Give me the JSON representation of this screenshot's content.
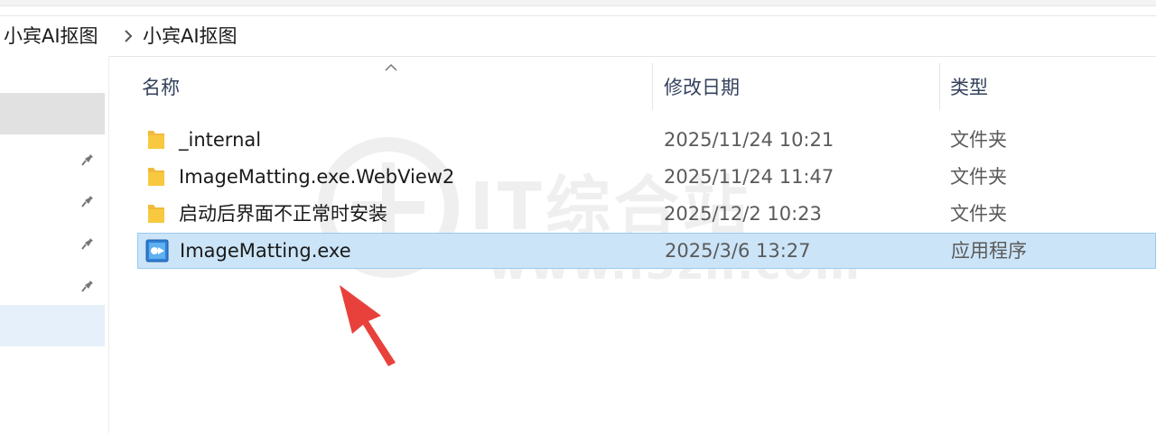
{
  "breadcrumb": {
    "items": [
      "小宾AI抠图",
      "小宾AI抠图"
    ]
  },
  "columns": {
    "name": "名称",
    "date": "修改日期",
    "type": "类型"
  },
  "files": [
    {
      "name": "_internal",
      "date": "2025/11/24 10:21",
      "type": "文件夹",
      "icon": "folder-icon",
      "selected": false
    },
    {
      "name": "ImageMatting.exe.WebView2",
      "date": "2025/11/24 11:47",
      "type": "文件夹",
      "icon": "folder-icon",
      "selected": false
    },
    {
      "name": "启动后界面不正常时安装",
      "date": "2025/12/2 10:23",
      "type": "文件夹",
      "icon": "folder-icon",
      "selected": false
    },
    {
      "name": "ImageMatting.exe",
      "date": "2025/3/6 13:27",
      "type": "应用程序",
      "icon": "app-exe-icon",
      "selected": true
    }
  ],
  "watermark": {
    "title": "IT综合站",
    "url": "www.i3zh.com"
  },
  "colors": {
    "selection_bg": "#cce4f7",
    "selection_border": "#99c9ef",
    "folder_yellow": "#f8c93f",
    "arrow_red": "#e8413c"
  }
}
